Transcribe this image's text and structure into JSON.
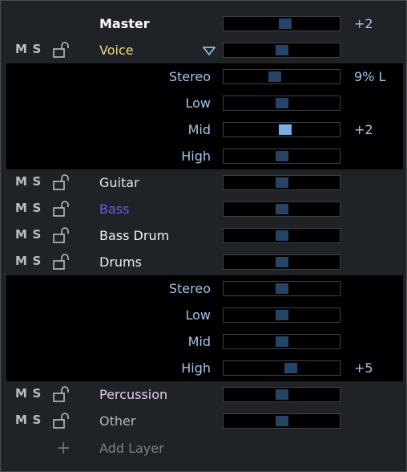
{
  "master": {
    "label": "Master",
    "value": "+2",
    "level": 0.53
  },
  "controls": {
    "mute": "M",
    "solo": "S"
  },
  "voice": {
    "name": "Voice",
    "color": "#eedc7a",
    "level": 0.5,
    "params": [
      {
        "label": "Stereo",
        "level": 0.44,
        "value": "9% L",
        "active": false
      },
      {
        "label": "Low",
        "level": 0.5,
        "value": "",
        "active": false
      },
      {
        "label": "Mid",
        "level": 0.53,
        "value": "+2",
        "active": true
      },
      {
        "label": "High",
        "level": 0.5,
        "value": "",
        "active": false
      }
    ]
  },
  "layers_mid": [
    {
      "name": "Guitar",
      "color": "#e0e3e8",
      "level": 0.5
    },
    {
      "name": "Bass",
      "color": "#6f5be6",
      "level": 0.5
    },
    {
      "name": "Bass Drum",
      "color": "#f0f2f5",
      "level": 0.5
    },
    {
      "name": "Drums",
      "color": "#e6ecf4",
      "level": 0.5
    }
  ],
  "drums_params": [
    {
      "label": "Stereo",
      "level": 0.5,
      "value": "",
      "active": false
    },
    {
      "label": "Low",
      "level": 0.5,
      "value": "",
      "active": false
    },
    {
      "label": "Mid",
      "level": 0.5,
      "value": "",
      "active": false
    },
    {
      "label": "High",
      "level": 0.58,
      "value": "+5",
      "active": false
    }
  ],
  "layers_bottom": [
    {
      "name": "Percussion",
      "color": "#e8c8ee",
      "level": 0.5
    },
    {
      "name": "Other",
      "color": "#b4b8bf",
      "level": 0.5
    }
  ],
  "add_layer": {
    "label": "Add Layer",
    "icon": "plus-icon"
  },
  "icons": {
    "lock": "lock-open-icon",
    "dropdown": "triangle-down-icon"
  }
}
